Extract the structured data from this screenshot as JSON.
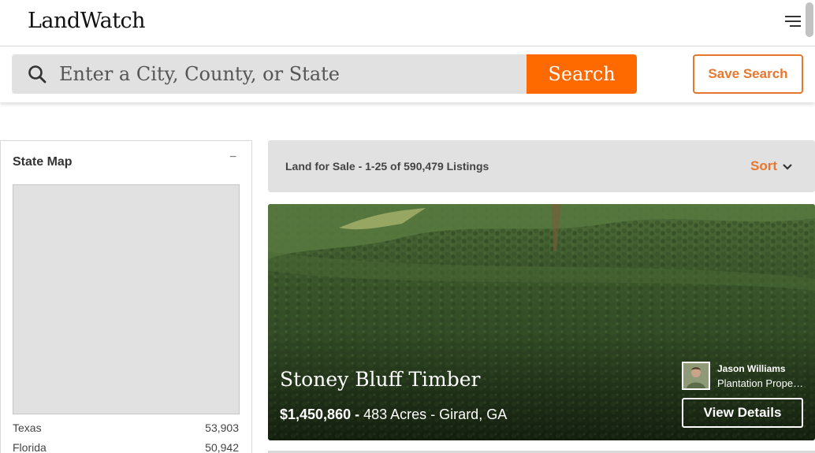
{
  "header": {
    "logo": "LandWatch",
    "menu_icon": "hamburger-menu-icon"
  },
  "search": {
    "placeholder": "Enter a City, County, or State",
    "value": "",
    "search_label": "Search",
    "save_label": "Save Search",
    "icon": "search-icon"
  },
  "sidebar": {
    "title": "State Map",
    "collapse_symbol": "−",
    "states": [
      {
        "name": "Texas",
        "count": "53,903"
      },
      {
        "name": "Florida",
        "count": "50,942"
      }
    ]
  },
  "results": {
    "summary": "Land for Sale - 1-25 of 590,479 Listings",
    "sort_label": "Sort"
  },
  "listing": {
    "title": "Stoney Bluff Timber",
    "price": "$1,450,860 -",
    "acres": "483 Acres",
    "location": " - Girard, GA",
    "agent_name": "Jason Williams",
    "agent_company": "Plantation Properties",
    "view_label": "View Details"
  },
  "colors": {
    "accent": "#ff6a00",
    "accent_text": "#e8772e",
    "panel_gray": "#e1e1e1"
  }
}
